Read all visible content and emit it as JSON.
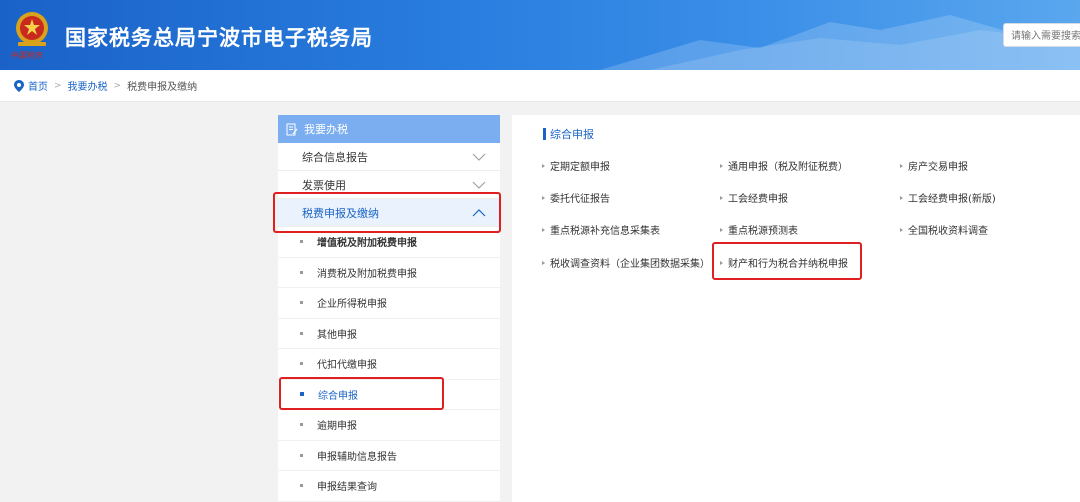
{
  "header": {
    "site_title": "国家税务总局宁波市电子税务局",
    "search_placeholder": "请输入需要搜索",
    "emblem_caption": "中国税务",
    "brand_color": "#2a7fe0"
  },
  "breadcrumb": {
    "items": [
      "首页",
      "我要办税",
      "税费申报及缴纳"
    ]
  },
  "sidebar": {
    "header": "我要办税",
    "groups": [
      {
        "label": "综合信息报告"
      },
      {
        "label": "发票使用"
      },
      {
        "label": "税费申报及缴纳"
      }
    ],
    "items": [
      {
        "label": "增值税及附加税费申报"
      },
      {
        "label": "消费税及附加税费申报"
      },
      {
        "label": "企业所得税申报"
      },
      {
        "label": "其他申报"
      },
      {
        "label": "代扣代缴申报"
      },
      {
        "label": "综合申报"
      },
      {
        "label": "逾期申报"
      },
      {
        "label": "申报辅助信息报告"
      },
      {
        "label": "申报结果查询"
      }
    ]
  },
  "main": {
    "section_title": "综合申报",
    "links": [
      "定期定额申报",
      "通用申报（税及附征税费）",
      "房产交易申报",
      "委托代征报告",
      "工会经费申报",
      "工会经费申报(新版)",
      "重点税源补充信息采集表",
      "重点税源预测表",
      "全国税收资料调查",
      "税收调查资料（企业集团数据采集）",
      "财产和行为税合并纳税申报"
    ]
  },
  "colors": {
    "highlight": "#e02020",
    "link_blue": "#1b64c5",
    "sidebar_header": "#7aaef0"
  }
}
